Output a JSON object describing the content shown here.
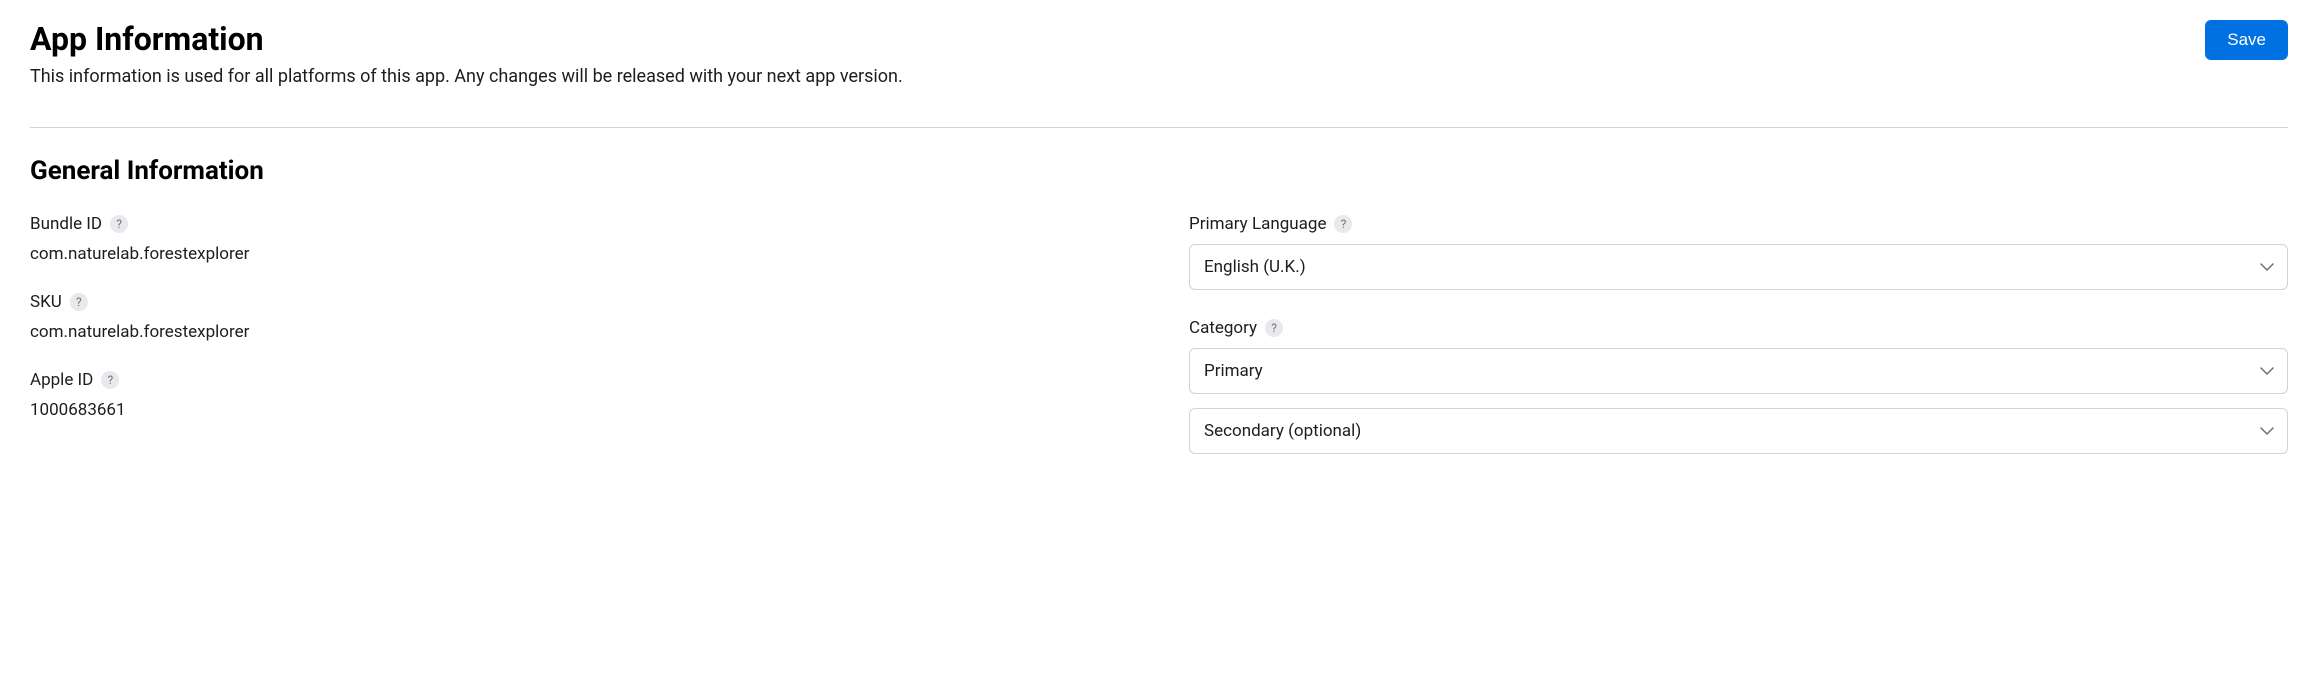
{
  "header": {
    "title": "App Information",
    "description": "This information is used for all platforms of this app. Any changes will be released with your next app version.",
    "save_label": "Save"
  },
  "section": {
    "title": "General Information"
  },
  "left": {
    "bundle_id": {
      "label": "Bundle ID",
      "value": "com.naturelab.forestexplorer"
    },
    "sku": {
      "label": "SKU",
      "value": "com.naturelab.forestexplorer"
    },
    "apple_id": {
      "label": "Apple ID",
      "value": "1000683661"
    }
  },
  "right": {
    "primary_language": {
      "label": "Primary Language",
      "value": "English (U.K.)"
    },
    "category": {
      "label": "Category",
      "primary_value": "Primary",
      "secondary_value": "Secondary (optional)"
    }
  },
  "help_symbol": "?"
}
